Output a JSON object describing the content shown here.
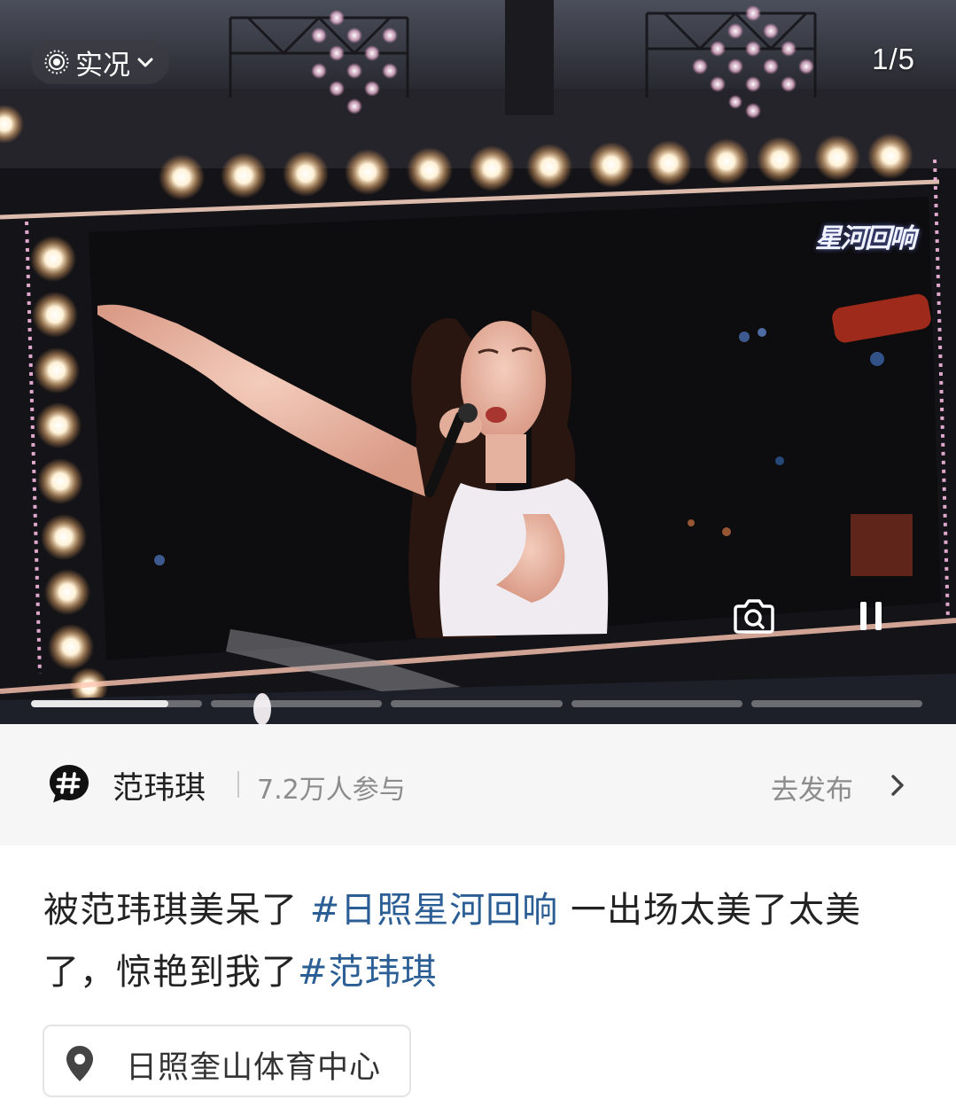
{
  "media": {
    "live_label": "实况",
    "counter": "1/5",
    "watermark": "星河回响",
    "progress": {
      "segments": 5,
      "active_index": 0,
      "active_fraction": 0.8
    }
  },
  "topic": {
    "name": "范玮琪",
    "participants": "7.2万人参与",
    "action": "去发布"
  },
  "caption": {
    "text_1": "被范玮琪美呆了 ",
    "tag_1": "#日照星河回响",
    "text_2": " 一出场太美了太美了，惊艳到我了",
    "tag_2": "#范玮琪"
  },
  "location": {
    "name": "日照奎山体育中心"
  },
  "colors": {
    "tag_blue": "#2b5e94",
    "topic_bg": "#f6f6f6",
    "muted_text": "#8c8c8c"
  }
}
